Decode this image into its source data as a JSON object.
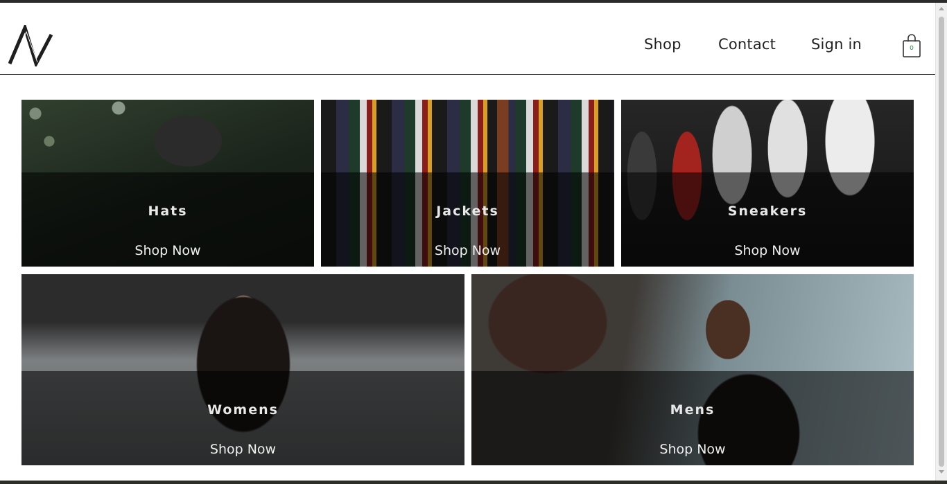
{
  "header": {
    "logo_alt": "N logo",
    "nav": [
      {
        "label": "Shop"
      },
      {
        "label": "Contact"
      },
      {
        "label": "Sign in"
      }
    ],
    "cart": {
      "count": "0",
      "icon": "shopping-bag-icon"
    }
  },
  "tiles": [
    {
      "title": "Hats",
      "cta": "Shop Now"
    },
    {
      "title": "Jackets",
      "cta": "Shop Now"
    },
    {
      "title": "Sneakers",
      "cta": "Shop Now"
    },
    {
      "title": "Womens",
      "cta": "Shop Now"
    },
    {
      "title": "Mens",
      "cta": "Shop Now"
    }
  ],
  "colors": {
    "overlay": "rgba(0,0,0,0.55)",
    "text_light": "#e8e8e8",
    "header_text": "#222222",
    "cart_count": "#2a8f4a"
  }
}
